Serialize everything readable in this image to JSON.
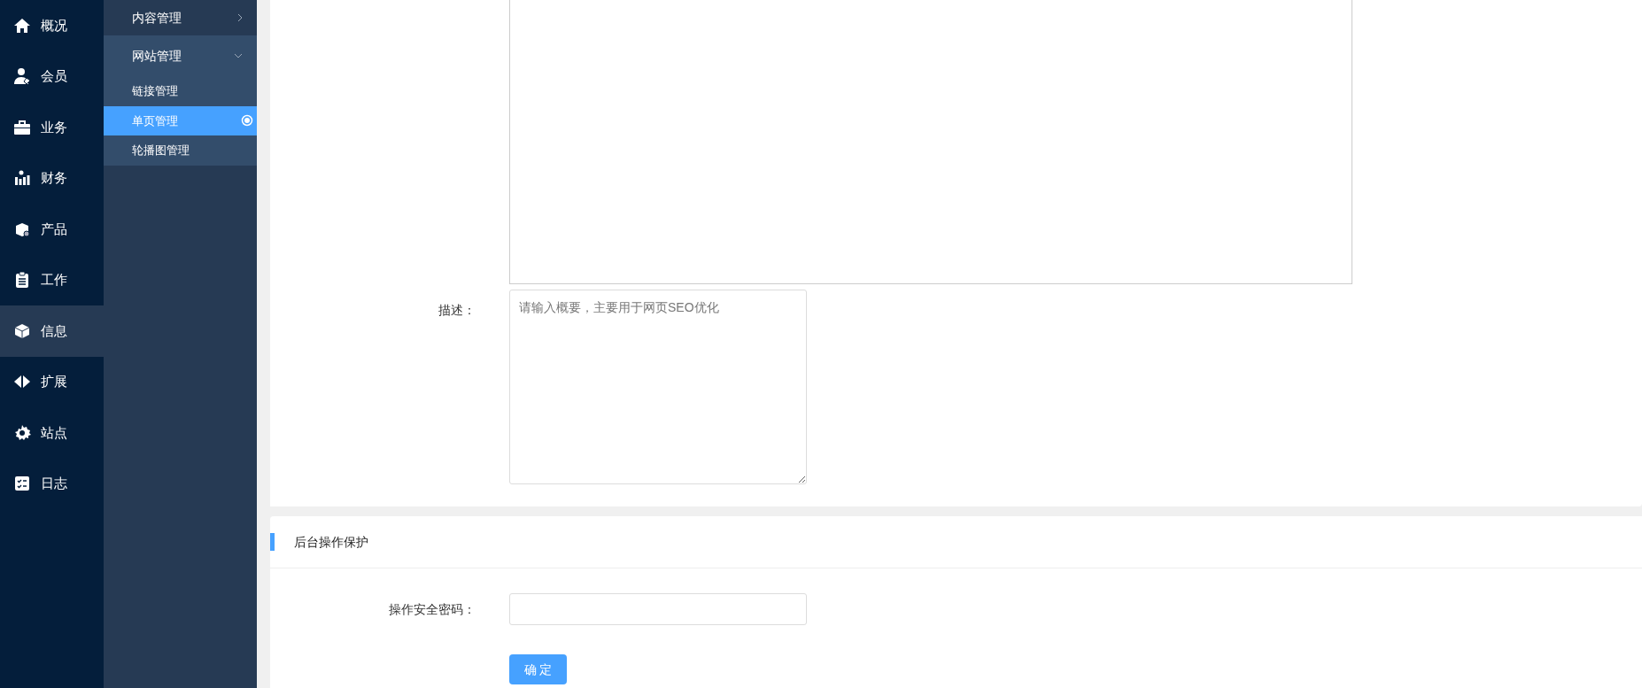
{
  "main_nav": [
    {
      "label": "概况",
      "selected": false
    },
    {
      "label": "会员",
      "selected": false
    },
    {
      "label": "业务",
      "selected": false
    },
    {
      "label": "财务",
      "selected": false
    },
    {
      "label": "产品",
      "selected": false
    },
    {
      "label": "工作",
      "selected": false
    },
    {
      "label": "信息",
      "selected": true
    },
    {
      "label": "扩展",
      "selected": false
    },
    {
      "label": "站点",
      "selected": false
    },
    {
      "label": "日志",
      "selected": false
    }
  ],
  "sub_nav": [
    {
      "label": "内容管理",
      "expanded": false
    },
    {
      "label": "网站管理",
      "expanded": true,
      "children": [
        {
          "label": "链接管理",
          "selected": false
        },
        {
          "label": "单页管理",
          "selected": true
        },
        {
          "label": "轮播图管理",
          "selected": false
        }
      ]
    }
  ],
  "content_form": {
    "description": {
      "label": "描述：",
      "placeholder": "请输入概要，主要用于网页SEO优化"
    }
  },
  "security_section": {
    "title": "后台操作保护",
    "password": {
      "label": "操作安全密码："
    },
    "submit_button": "确 定"
  }
}
